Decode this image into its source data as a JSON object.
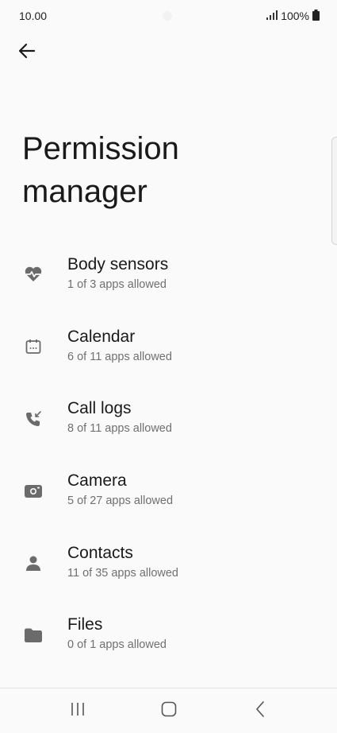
{
  "status_bar": {
    "time": "10.00",
    "battery": "100%"
  },
  "page": {
    "title": "Permission manager"
  },
  "permissions": [
    {
      "name": "Body sensors",
      "summary": "1 of 3 apps allowed",
      "icon": "heart-pulse-icon"
    },
    {
      "name": "Calendar",
      "summary": "6 of 11 apps allowed",
      "icon": "calendar-icon"
    },
    {
      "name": "Call logs",
      "summary": "8 of 11 apps allowed",
      "icon": "call-log-icon"
    },
    {
      "name": "Camera",
      "summary": "5 of 27 apps allowed",
      "icon": "camera-icon"
    },
    {
      "name": "Contacts",
      "summary": "11 of 35 apps allowed",
      "icon": "person-icon"
    },
    {
      "name": "Files",
      "summary": "0 of 1 apps allowed",
      "icon": "folder-icon"
    }
  ],
  "colors": {
    "icon_gray": "#6b6b6b",
    "background": "#fafafa"
  }
}
